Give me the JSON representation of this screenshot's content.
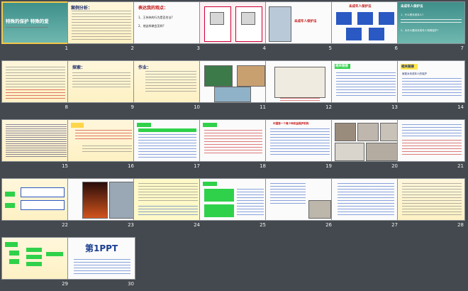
{
  "slide_numbers": [
    "1",
    "2",
    "3",
    "4",
    "5",
    "6",
    "7",
    "8",
    "9",
    "10",
    "11",
    "12",
    "13",
    "14",
    "15",
    "16",
    "17",
    "18",
    "19",
    "20",
    "21",
    "22",
    "23",
    "24",
    "25",
    "26",
    "27",
    "28",
    "29",
    "30"
  ],
  "slides": {
    "s1": {
      "title": "特殊的保护  特殊的爱"
    },
    "s2": {
      "heading": "案例分析："
    },
    "s3": {
      "heading": "表达我的观点：",
      "q1": "1、王伟伟的行为是否合法?",
      "q2": "2、他这样做会怎样?"
    },
    "s5": {
      "caption": "未成年人保护法"
    },
    "s6": {
      "heading": "未成年人保护法"
    },
    "s7": {
      "heading": "未成年人保护法",
      "q": "1、什么是未成年人?",
      "q2": "2、为什么要对未成年人特殊保护?"
    },
    "s9": {
      "heading": "探索："
    },
    "s10": {
      "heading": "作业："
    },
    "s13": {
      "heading": "相关链接"
    },
    "s14": {
      "heading": "相关链接",
      "sub": "家庭对未成年人的保护"
    },
    "s19": {
      "heading": "中国第一个青少年权益保护机构"
    },
    "s30": {
      "logo": "第1PPT",
      "logo_accent": "PPT"
    }
  },
  "colors": {
    "background": "#44494f",
    "selection": "#f2c84b",
    "heading_blue": "#1a2a6c",
    "accent_red": "#c41212",
    "accent_green": "#2fd14a"
  }
}
